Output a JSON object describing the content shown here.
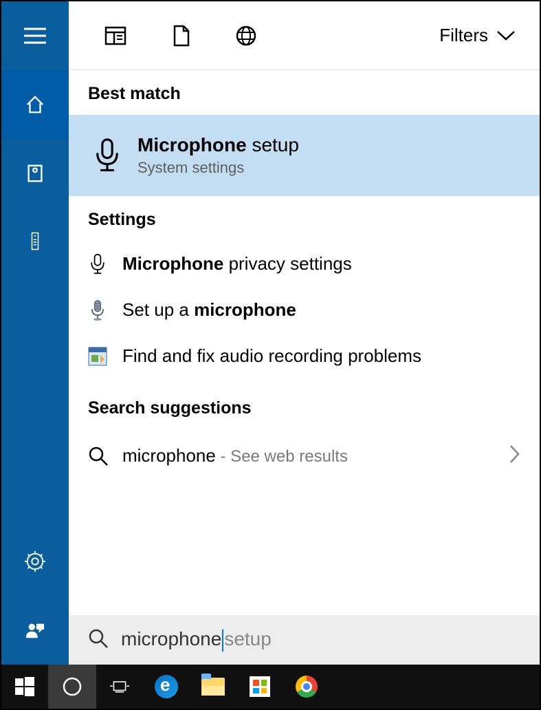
{
  "sidebar": {
    "items": [
      "menu",
      "home",
      "apps",
      "remote",
      "settings",
      "people"
    ]
  },
  "topbar": {
    "filter_icons": [
      "news",
      "document",
      "web"
    ],
    "filters_label": "Filters"
  },
  "sections": {
    "best_match": "Best match",
    "settings": "Settings",
    "search_suggestions": "Search suggestions"
  },
  "best_match": {
    "title_bold": "Microphone",
    "title_rest": " setup",
    "subtitle": "System settings"
  },
  "settings_results": [
    {
      "bold": "Microphone",
      "rest": " privacy settings"
    },
    {
      "pre": "Set up a ",
      "bold": "microphone"
    },
    {
      "plain": "Find and fix audio recording problems"
    }
  ],
  "search_suggestion": {
    "term": "microphone",
    "note": " - See web results"
  },
  "search_input": {
    "typed": "microphone",
    "completion": "setup"
  },
  "taskbar": {
    "items": [
      "start",
      "cortana",
      "task-view",
      "edge",
      "explorer",
      "store",
      "chrome"
    ]
  }
}
